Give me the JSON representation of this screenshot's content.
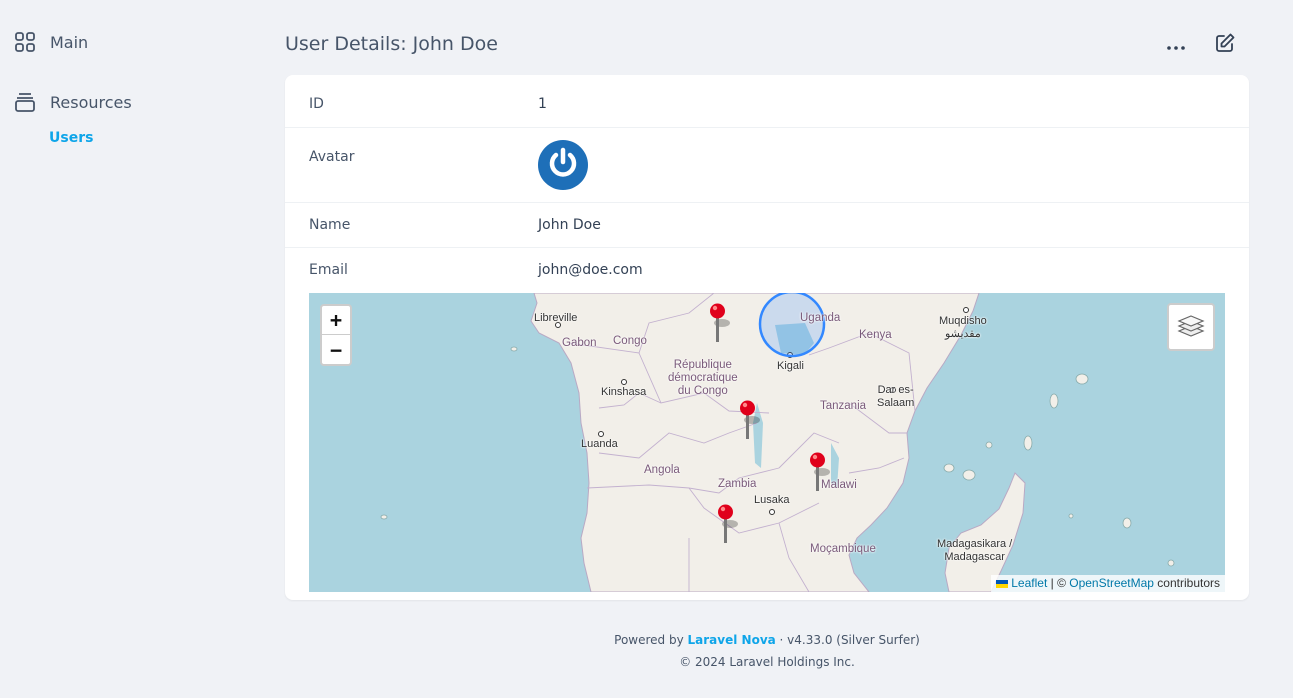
{
  "sidebar": {
    "main_label": "Main",
    "resources_label": "Resources",
    "users_label": "Users"
  },
  "header": {
    "title": "User Details: John Doe"
  },
  "fields": {
    "id": {
      "label": "ID",
      "value": "1"
    },
    "avatar": {
      "label": "Avatar"
    },
    "name": {
      "label": "Name",
      "value": "John Doe"
    },
    "email": {
      "label": "Email",
      "value": "john@doe.com"
    }
  },
  "map": {
    "zoom_in": "+",
    "zoom_out": "−",
    "labels": {
      "libreville": "Libreville",
      "gabon": "Gabon",
      "congo": "Congo",
      "drc": "République\ndémocratique\ndu Congo",
      "kinshasa": "Kinshasa",
      "luanda": "Luanda",
      "angola": "Angola",
      "zambia": "Zambia",
      "lusaka": "Lusaka",
      "malawi": "Malawi",
      "mocambique": "Moçambique",
      "tanzania": "Tanzania",
      "dar": "Dar es-\nSalaam",
      "kigali": "Kigali",
      "uganda": "Uganda",
      "kenya": "Kenya",
      "muqdisho": "Muqdisho\nمقديشو",
      "madagascar": "Madagasikara /\nMadagascar"
    },
    "attribution": {
      "leaflet": "Leaflet",
      "separator": " | © ",
      "osm": "OpenStreetMap",
      "contributors": " contributors"
    },
    "circle_color": "#3388ff",
    "marker_color": "#e0001b"
  },
  "footer": {
    "powered_by": "Powered by ",
    "nova_link": "Laravel Nova",
    "version": " · v4.33.0 (Silver Surfer)",
    "copyright": "© 2024 Laravel Holdings Inc."
  },
  "colors": {
    "accent": "#0ea5e9",
    "avatar_bg": "#1e6fb8",
    "water": "#aad3df",
    "land": "#f2efe9"
  }
}
